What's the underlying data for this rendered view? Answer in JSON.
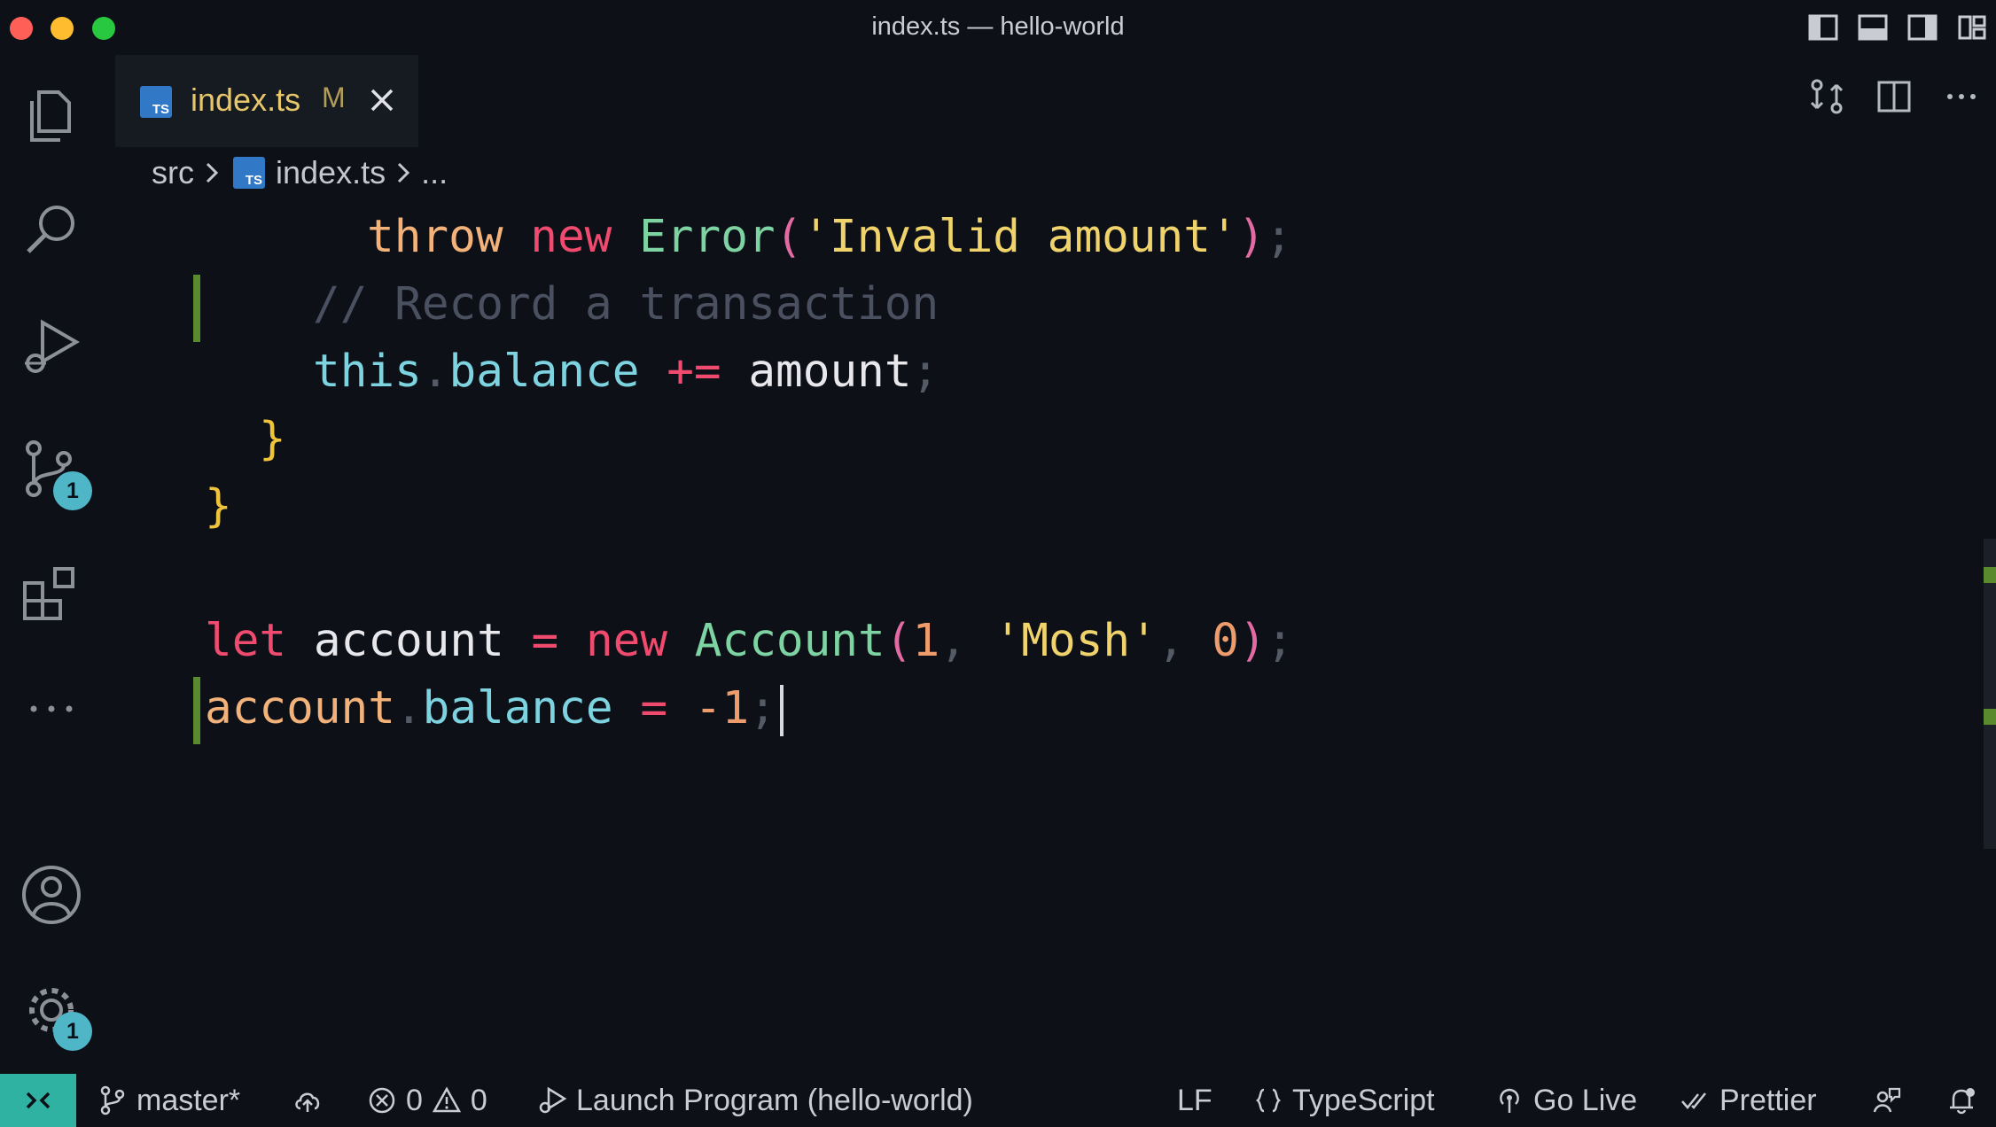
{
  "window": {
    "title": "index.ts — hello-world",
    "layout_icons": [
      "toggle-primary-sidebar-icon",
      "toggle-panel-icon",
      "toggle-secondary-sidebar-icon",
      "customize-layout-icon"
    ]
  },
  "activity_bar": {
    "items": [
      "explorer-icon",
      "search-icon",
      "run-debug-icon",
      "source-control-icon",
      "extensions-icon",
      "more-icon"
    ],
    "source_control_badge": "1",
    "bottom": [
      "accounts-icon",
      "manage-gear-icon"
    ],
    "manage_badge": "1"
  },
  "tab": {
    "file_label": "index.ts",
    "modified_marker": "M"
  },
  "breadcrumb": {
    "folder": "src",
    "file": "index.ts",
    "more": "..."
  },
  "code": {
    "lines": [
      {
        "tokens": [
          "throw",
          "new",
          "Error",
          "(",
          "'Invalid amount'",
          ")",
          ";"
        ]
      },
      {
        "tokens": [
          "// Record a transaction"
        ]
      },
      {
        "tokens": [
          "this",
          ".",
          "balance",
          "+=",
          "amount",
          ";"
        ]
      },
      {
        "tokens": [
          "}"
        ]
      },
      {
        "tokens": [
          "}"
        ]
      },
      {
        "tokens": []
      },
      {
        "tokens": [
          "let",
          "account",
          "=",
          "new",
          "Account",
          "(",
          "1",
          ",",
          "'Mosh'",
          ",",
          "0",
          ")",
          ";"
        ]
      },
      {
        "tokens": [
          "account",
          ".",
          "balance",
          "=",
          "-1",
          ";"
        ]
      }
    ]
  },
  "status_bar": {
    "branch": "master*",
    "errors": "0",
    "warnings": "0",
    "launch": "Launch Program (hello-world)",
    "eol": "LF",
    "language": "TypeScript",
    "go_live": "Go Live",
    "prettier": "Prettier"
  },
  "colors": {
    "background": "#0d1117",
    "keyword": "#f04a6f",
    "string": "#f1d36b",
    "class": "#7ed3a2",
    "property": "#7dd3e0",
    "number": "#ee9c6b",
    "brace": "#f0c43a",
    "remote_indicator": "#2fb2a2",
    "git_added_marker": "#5a8a2e"
  }
}
